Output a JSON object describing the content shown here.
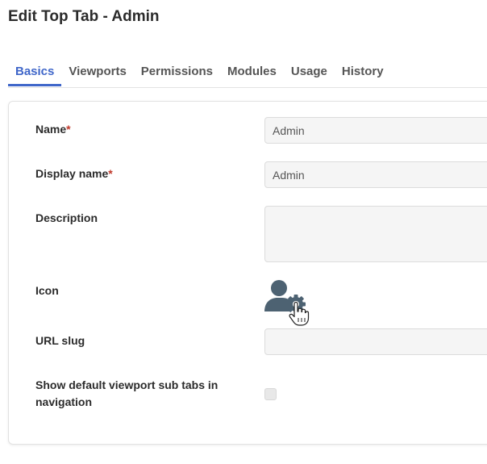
{
  "header": {
    "title": "Edit Top Tab - Admin"
  },
  "tabs": [
    {
      "label": "Basics",
      "active": true
    },
    {
      "label": "Viewports"
    },
    {
      "label": "Permissions"
    },
    {
      "label": "Modules"
    },
    {
      "label": "Usage"
    },
    {
      "label": "History"
    }
  ],
  "form": {
    "required_marker": "*",
    "name": {
      "label": "Name",
      "value": "Admin",
      "required": true
    },
    "display_name": {
      "label": "Display name",
      "value": "Admin",
      "required": true
    },
    "description": {
      "label": "Description",
      "value": ""
    },
    "icon": {
      "label": "Icon",
      "icon_name": "user-gear-icon",
      "cursor": "hand-pointer-cursor"
    },
    "url_slug": {
      "label": "URL slug",
      "value": ""
    },
    "show_default_viewport": {
      "label": "Show default viewport sub tabs in navigation",
      "checked": false
    }
  },
  "colors": {
    "accent": "#3f66c9",
    "required": "#c0392b",
    "icon": "#4d6272"
  }
}
